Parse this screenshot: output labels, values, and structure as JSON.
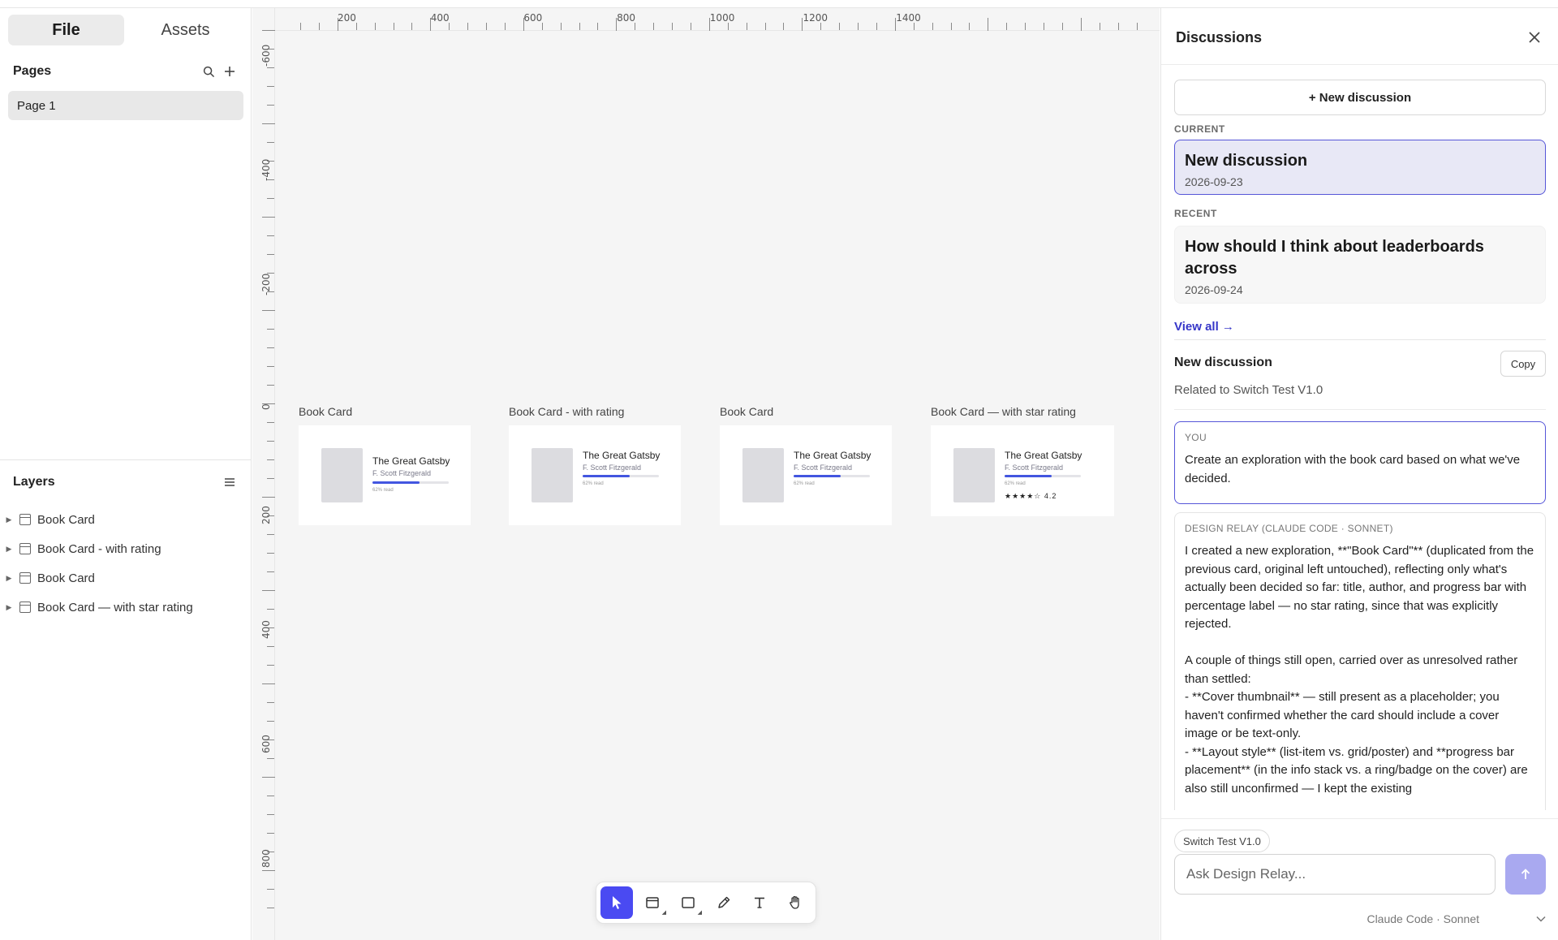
{
  "left_panel": {
    "tabs": [
      {
        "label": "File"
      },
      {
        "label": "Assets"
      }
    ],
    "pages": {
      "title": "Pages",
      "items": [
        {
          "label": "Page 1"
        }
      ]
    },
    "layers": {
      "title": "Layers",
      "items": [
        {
          "label": "Book Card"
        },
        {
          "label": "Book Card - with rating"
        },
        {
          "label": "Book Card"
        },
        {
          "label": "Book Card — with star rating"
        }
      ]
    }
  },
  "canvas": {
    "ruler_top": [
      "200",
      "400",
      "600",
      "800",
      "1000",
      "1200",
      "1400"
    ],
    "ruler_left": [
      "-600",
      "-400",
      "-200",
      "0",
      "200",
      "400",
      "600",
      "800"
    ],
    "frames": [
      {
        "label": "Book Card",
        "title": "The Great Gatsby",
        "author": "F. Scott Fitzgerald",
        "progress_label": "62% read",
        "progress": 0.62
      },
      {
        "label": "Book Card - with rating",
        "title": "The Great Gatsby",
        "author": "F. Scott Fitzgerald",
        "progress_label": "62% read",
        "progress": 0.62
      },
      {
        "label": "Book Card",
        "title": "The Great Gatsby",
        "author": "F. Scott Fitzgerald",
        "progress_label": "62% read",
        "progress": 0.62
      },
      {
        "label": "Book Card — with star rating",
        "title": "The Great Gatsby",
        "author": "F. Scott Fitzgerald",
        "progress_label": "62% read",
        "progress": 0.62,
        "stars": "★★★★☆",
        "rating": "4.2"
      }
    ],
    "toolbar": [
      {
        "name": "select-tool",
        "icon": "cursor-icon",
        "active": true
      },
      {
        "name": "frame-tool",
        "icon": "frame-icon"
      },
      {
        "name": "rectangle-tool",
        "icon": "rectangle-icon"
      },
      {
        "name": "pen-tool",
        "icon": "pen-icon"
      },
      {
        "name": "text-tool",
        "icon": "text-icon"
      },
      {
        "name": "hand-tool",
        "icon": "hand-icon"
      }
    ]
  },
  "discussions": {
    "title": "Discussions",
    "new_button": "+ New discussion",
    "current_label": "CURRENT",
    "current": {
      "title": "New discussion",
      "date": "2026-09-23"
    },
    "recent_label": "RECENT",
    "recent": [
      {
        "title": "How should I think about leaderboards across",
        "date": "2026-09-24"
      }
    ],
    "view_all": "View all →",
    "conversation": {
      "title": "New discussion",
      "copy_label": "Copy",
      "related": "Related to Switch Test V1.0",
      "messages": [
        {
          "role": "YOU",
          "text": "Create an exploration with the book card based on what we've decided."
        },
        {
          "role": "DESIGN RELAY (CLAUDE CODE · SONNET)",
          "text": "I created a new exploration, **\"Book Card\"** (duplicated from the previous card, original left untouched), reflecting only what's actually been decided so far: title, author, and progress bar with percentage label — no star rating, since that was explicitly rejected.\n\nA couple of things still open, carried over as unresolved rather than settled:\n- **Cover thumbnail** — still present as a placeholder; you haven't confirmed whether the card should include a cover image or be text-only.\n- **Layout style** (list-item vs. grid/poster) and **progress bar placement** (in the info stack vs. a ring/badge on the cover) are also still unconfirmed — I kept the existing"
        }
      ]
    },
    "context_chip": "Switch Test V1.0",
    "input_placeholder": "Ask Design Relay...",
    "model": "Claude Code · Sonnet",
    "accent_color": "#4a4af2"
  }
}
